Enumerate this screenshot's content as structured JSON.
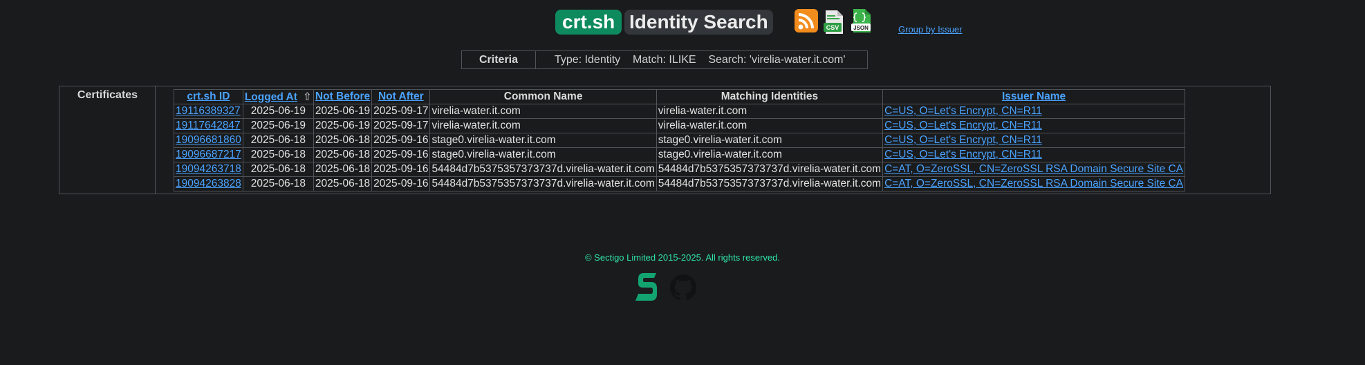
{
  "header": {
    "logo": "crt.sh",
    "title": "Identity Search",
    "group_link": "Group by Issuer",
    "icons": [
      "rss-feed-icon",
      "csv-download-icon",
      "json-download-icon"
    ],
    "csv_badge": "CSV",
    "json_badge": "JSON"
  },
  "criteria": {
    "label": "Criteria",
    "text": "Type: Identity    Match: ILIKE    Search: 'virelia-water.it.com'"
  },
  "results": {
    "label": "Certificates",
    "columns": {
      "id": "crt.sh ID",
      "logged_at": "Logged At",
      "logged_at_sort": "⇧",
      "not_before": "Not Before",
      "not_after": "Not After",
      "common_name": "Common Name",
      "matching_identities": "Matching Identities",
      "issuer_name": "Issuer Name"
    },
    "rows": [
      {
        "id": "19116389327",
        "logged_at": "2025-06-19",
        "not_before": "2025-06-19",
        "not_after": "2025-09-17",
        "common_name": "virelia-water.it.com",
        "matching": "virelia-water.it.com",
        "issuer": "C=US, O=Let's Encrypt, CN=R11"
      },
      {
        "id": "19117642847",
        "logged_at": "2025-06-19",
        "not_before": "2025-06-19",
        "not_after": "2025-09-17",
        "common_name": "virelia-water.it.com",
        "matching": "virelia-water.it.com",
        "issuer": "C=US, O=Let's Encrypt, CN=R11"
      },
      {
        "id": "19096681860",
        "logged_at": "2025-06-18",
        "not_before": "2025-06-18",
        "not_after": "2025-09-16",
        "common_name": "stage0.virelia-water.it.com",
        "matching": "stage0.virelia-water.it.com",
        "issuer": "C=US, O=Let's Encrypt, CN=R11"
      },
      {
        "id": "19096687217",
        "logged_at": "2025-06-18",
        "not_before": "2025-06-18",
        "not_after": "2025-09-16",
        "common_name": "stage0.virelia-water.it.com",
        "matching": "stage0.virelia-water.it.com",
        "issuer": "C=US, O=Let's Encrypt, CN=R11"
      },
      {
        "id": "19094263718",
        "logged_at": "2025-06-18",
        "not_before": "2025-06-18",
        "not_after": "2025-09-16",
        "common_name": "54484d7b5375357373737d.virelia-water.it.com",
        "matching": "54484d7b5375357373737d.virelia-water.it.com",
        "issuer": "C=AT, O=ZeroSSL, CN=ZeroSSL RSA Domain Secure Site CA"
      },
      {
        "id": "19094263828",
        "logged_at": "2025-06-18",
        "not_before": "2025-06-18",
        "not_after": "2025-09-16",
        "common_name": "54484d7b5375357373737d.virelia-water.it.com",
        "matching": "54484d7b5375357373737d.virelia-water.it.com",
        "issuer": "C=AT, O=ZeroSSL, CN=ZeroSSL RSA Domain Secure Site CA"
      }
    ]
  },
  "footer": {
    "copyright": "© Sectigo Limited 2015-2025. All rights reserved.",
    "icons": [
      "sectigo-logo-icon",
      "github-icon"
    ]
  },
  "colors": {
    "background": "#1a1b1d",
    "brand_green": "#0e8a5f",
    "link_blue": "#4aa3ff",
    "footer_text": "#2ee6a8",
    "rss_orange": "#f28c1d"
  }
}
